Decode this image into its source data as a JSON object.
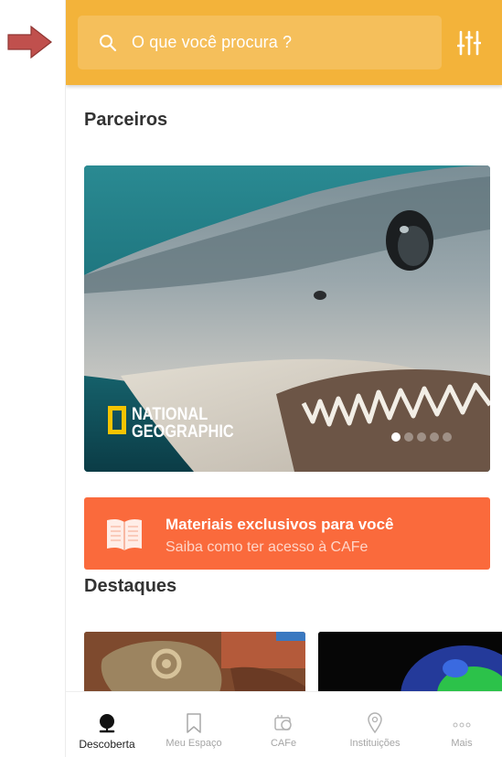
{
  "search": {
    "placeholder": "O que você procura ?"
  },
  "sections": {
    "partners_title": "Parceiros",
    "highlights_title": "Destaques"
  },
  "banner": {
    "logo_line1": "NATIONAL",
    "logo_line2": "GEOGRAPHIC",
    "slide_count": 5,
    "active_slide": 1
  },
  "promo": {
    "title": "Materiais exclusivos para você",
    "subtitle": "Saiba como ter acesso à CAFe"
  },
  "nav": {
    "items": [
      {
        "label": "Descoberta",
        "icon": "globe-icon",
        "active": true
      },
      {
        "label": "Meu Espaço",
        "icon": "bookmark-icon",
        "active": false
      },
      {
        "label": "CAFe",
        "icon": "cafe-icon",
        "active": false
      },
      {
        "label": "Instituições",
        "icon": "location-pin-icon",
        "active": false
      },
      {
        "label": "Mais",
        "icon": "more-icon",
        "active": false
      }
    ]
  },
  "colors": {
    "header": "#f3b33a",
    "promo": "#fa6a3c",
    "arrow": "#c0504d",
    "logo_yellow": "#f5c400"
  }
}
